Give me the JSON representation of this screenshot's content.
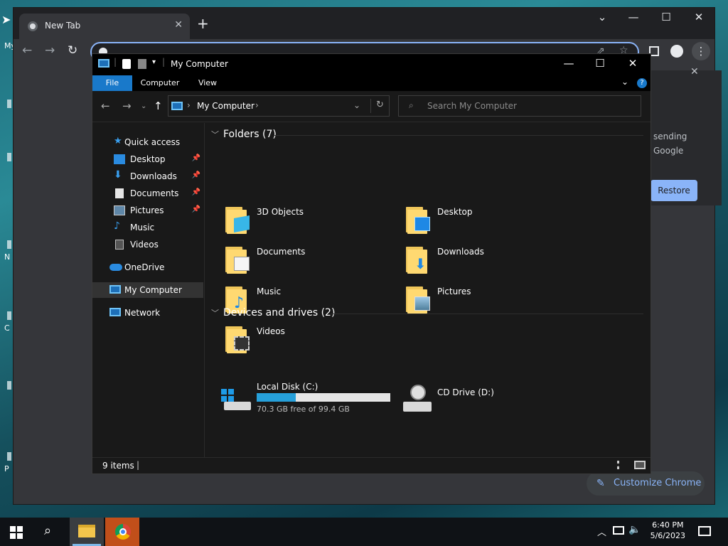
{
  "desktop": {
    "letters": [
      "My",
      "N",
      "C",
      "P"
    ]
  },
  "chrome": {
    "tab_title": "New Tab",
    "tab_close": "✕",
    "new_tab": "+",
    "side_text_1": "sending",
    "side_text_2": "Google",
    "restore_label": "Restore",
    "customize_label": "Customize Chrome",
    "panel_close": "✕"
  },
  "explorer": {
    "title": "My Computer",
    "ribbon_tabs": [
      "File",
      "Computer",
      "View"
    ],
    "help": "?",
    "address": "My Computer",
    "search_placeholder": "Search My Computer",
    "nav": [
      {
        "label": "Quick access",
        "icon": "star-icon"
      },
      {
        "label": "Desktop",
        "icon": "desktop-icon",
        "pinned": true
      },
      {
        "label": "Downloads",
        "icon": "download-icon",
        "pinned": true
      },
      {
        "label": "Documents",
        "icon": "documents-icon",
        "pinned": true
      },
      {
        "label": "Pictures",
        "icon": "pictures-icon",
        "pinned": true
      },
      {
        "label": "Music",
        "icon": "music-icon"
      },
      {
        "label": "Videos",
        "icon": "videos-icon"
      },
      {
        "label": "OneDrive",
        "icon": "cloud-icon"
      },
      {
        "label": "My Computer",
        "icon": "computer-icon",
        "selected": true
      },
      {
        "label": "Network",
        "icon": "network-icon"
      }
    ],
    "folders_header": "Folders (7)",
    "folders": [
      "3D Objects",
      "Desktop",
      "Documents",
      "Downloads",
      "Music",
      "Pictures",
      "Videos"
    ],
    "devices_header": "Devices and drives (2)",
    "drives": [
      {
        "name": "Local Disk (C:)",
        "free_text": "70.3 GB free of 99.4 GB",
        "used_fraction": 0.293
      },
      {
        "name": "CD Drive (D:)"
      }
    ],
    "status": "9 items"
  },
  "taskbar": {
    "time": "6:40 PM",
    "date": "5/6/2023"
  },
  "colors": {
    "accent": "#1979ca",
    "drive_bar": "#26a0da",
    "chrome_blue": "#8ab4f8"
  }
}
